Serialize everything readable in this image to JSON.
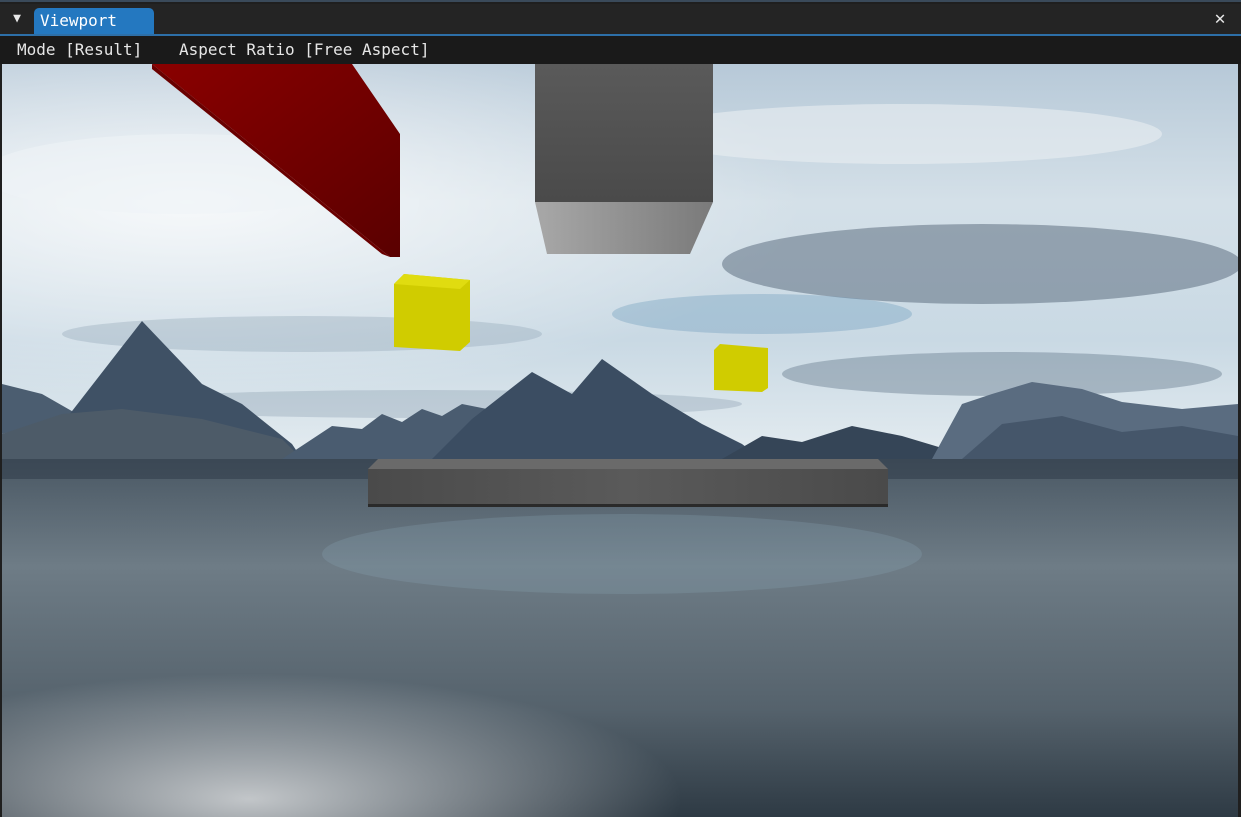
{
  "window": {
    "tab_label": "Viewport",
    "collapse_icon": "triangle-down-icon",
    "close_icon": "close-icon",
    "close_glyph": "✕",
    "collapse_glyph": "▼"
  },
  "menu": {
    "mode_label": "Mode [Result]",
    "aspect_label": "Aspect Ratio [Free Aspect]"
  },
  "scene": {
    "description_colors": {
      "sky_top": "#a9c3d8",
      "sky_horizon": "#e8eef2",
      "water_dark": "#2e3a44",
      "water_light": "#7f8b93",
      "red_beam": "#7a0000",
      "gray_box": "#6a6a6a",
      "yellow_cube": "#d4d000",
      "platform": "#3c3c3c",
      "mountains": "#3b4c5e"
    }
  }
}
